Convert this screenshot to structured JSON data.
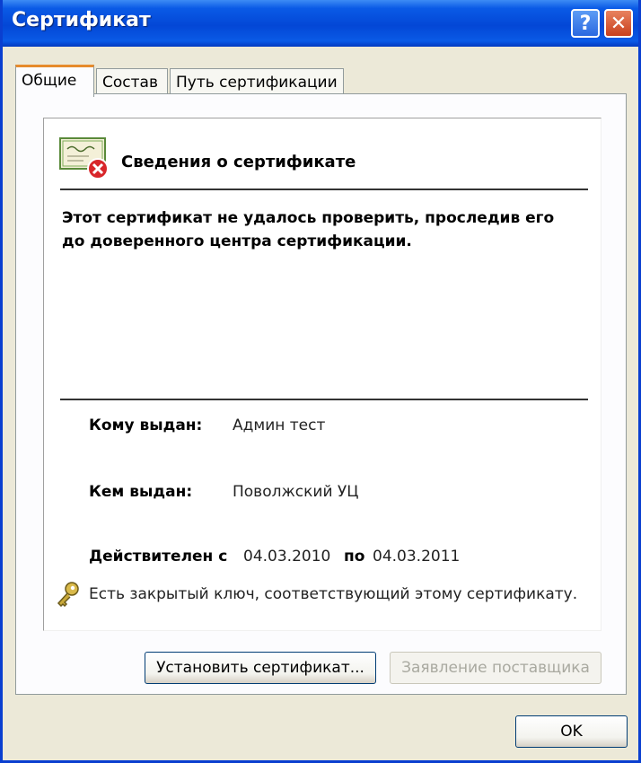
{
  "window": {
    "title": "Сертификат"
  },
  "titlebar": {
    "help_label": "?",
    "close_label": "✕"
  },
  "tabs": [
    {
      "label": "Общие",
      "active": true
    },
    {
      "label": "Состав",
      "active": false
    },
    {
      "label": "Путь сертификации",
      "active": false
    }
  ],
  "info": {
    "title": "Сведения о сертификате",
    "warning": "Этот сертификат не удалось проверить, проследив его до доверенного центра сертификации.",
    "issued_to_label": "Кому выдан:",
    "issued_to_value": "Админ тест",
    "issued_by_label": "Кем выдан:",
    "issued_by_value": "Поволжский УЦ",
    "valid_from_label": "Действителен с",
    "valid_from_value": "04.03.2010",
    "valid_to_label": "по",
    "valid_to_value": "04.03.2011",
    "private_key_note": "Есть закрытый ключ, соответствующий этому сертификату."
  },
  "buttons": {
    "install": "Установить сертификат...",
    "issuer_statement": "Заявление поставщика",
    "ok": "OK"
  },
  "icons": {
    "certificate": "certificate-error-icon",
    "key": "key-icon"
  },
  "colors": {
    "titlebar": "#0347d6",
    "active_tab_accent": "#e68b2c",
    "error_badge": "#d8262a"
  }
}
